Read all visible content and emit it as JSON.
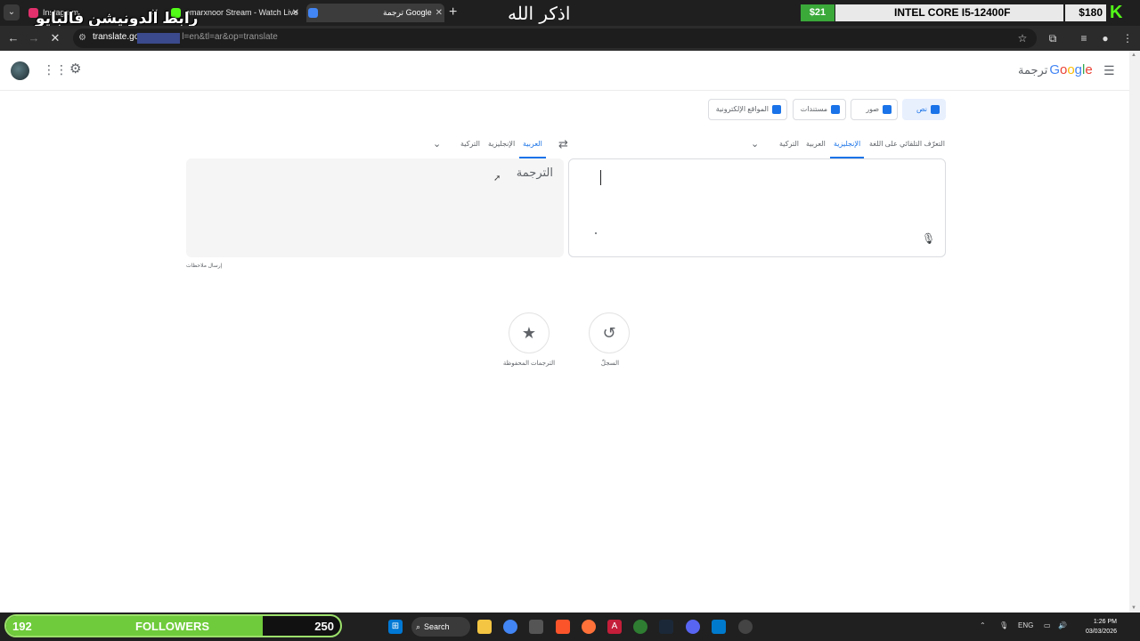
{
  "browser": {
    "tabs": [
      {
        "title": "Instagram",
        "favicon_color": "#e1306c"
      },
      {
        "title": "omarxnoor Stream - Watch Live",
        "favicon_color": "#53fc18"
      },
      {
        "title": "ترجمة Google",
        "favicon_color": "#4285f4"
      }
    ],
    "url_host": "translate.go",
    "url_rest": "l=en&tl=ar&op=translate"
  },
  "overlay": {
    "name_text": "رابط الدونيشن فالبايو",
    "dhikr_text": "اذكر الله",
    "money": "$21",
    "cpu": "INTEL CORE I5-12400F",
    "price": "$180",
    "kick_logo": "K"
  },
  "translate": {
    "brand_word": "ترجمة",
    "brand_letters": [
      "G",
      "o",
      "o",
      "g",
      "l",
      "e"
    ],
    "modes": [
      {
        "label": "نص",
        "icon": "translate-icon",
        "active": true
      },
      {
        "label": "صور",
        "icon": "image-icon",
        "active": false
      },
      {
        "label": "مستندات",
        "icon": "document-icon",
        "active": false
      },
      {
        "label": "المواقع الإلكترونية",
        "icon": "website-icon",
        "active": false
      }
    ],
    "source_langs": [
      "التعرّف التلقائي على اللغة",
      "الإنجليزية",
      "العربية",
      "التركية"
    ],
    "target_langs": [
      "العربية",
      "الإنجليزية",
      "التركية"
    ],
    "target_placeholder": "الترجمة",
    "feedback": "إرسال ملاحظات",
    "history_label": "السجلّ",
    "saved_label": "الترجمات المحفوظة"
  },
  "taskbar": {
    "followers_current": "192",
    "followers_label": "FOLLOWERS",
    "followers_goal": "250",
    "followers_progress": 0.768,
    "search_label": "Search",
    "lang": "ENG",
    "time": "1:26 PM",
    "date": "03/03/2026"
  }
}
